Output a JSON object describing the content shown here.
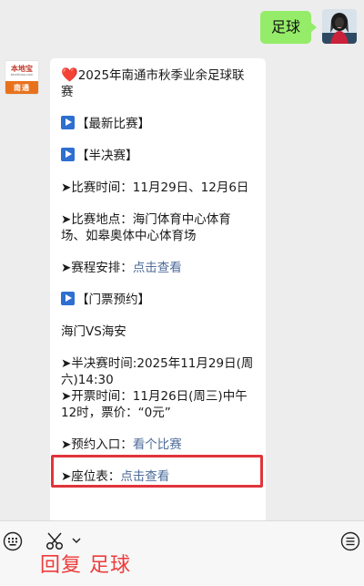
{
  "outgoing_message": "足球",
  "account": {
    "avatar_brand": "本地宝",
    "avatar_sub": "bendibao.com",
    "avatar_city": "南通"
  },
  "message": {
    "title_heart": "❤️",
    "title": "2025年南通市秋季业余足球联赛",
    "section_latest": "【最新比赛】",
    "section_semifinal": "【半决赛】",
    "time_line": "➤比赛时间：11月29日、12月6日",
    "venue_line": "➤比赛地点：海门体育中心体育场、如皋奥体中心体育场",
    "schedule_label": "➤赛程安排：",
    "schedule_link": "点击查看",
    "section_tickets": "【门票预约】",
    "match": "海门VS海安",
    "semifinal_time": "➤半决赛时间:2025年11月29日(周六)14:30",
    "ticket_time": "➤开票时间：11月26日(周三)中午12时，票价：“0元”",
    "booking_label": "➤预约入口：",
    "booking_link": "看个比赛",
    "seat_label": "➤座位表：",
    "seat_link": "点击查看"
  },
  "toolbar": {
    "reply_text": "回复 足球",
    "keyboard_icon": "keyboard-icon",
    "scissors_icon": "scissors-icon",
    "menu_icon": "menu-icon"
  },
  "colors": {
    "bubble_out": "#95ec69",
    "link": "#4d6c9a",
    "highlight": "#e1343b",
    "reply": "#ee3b3b"
  }
}
